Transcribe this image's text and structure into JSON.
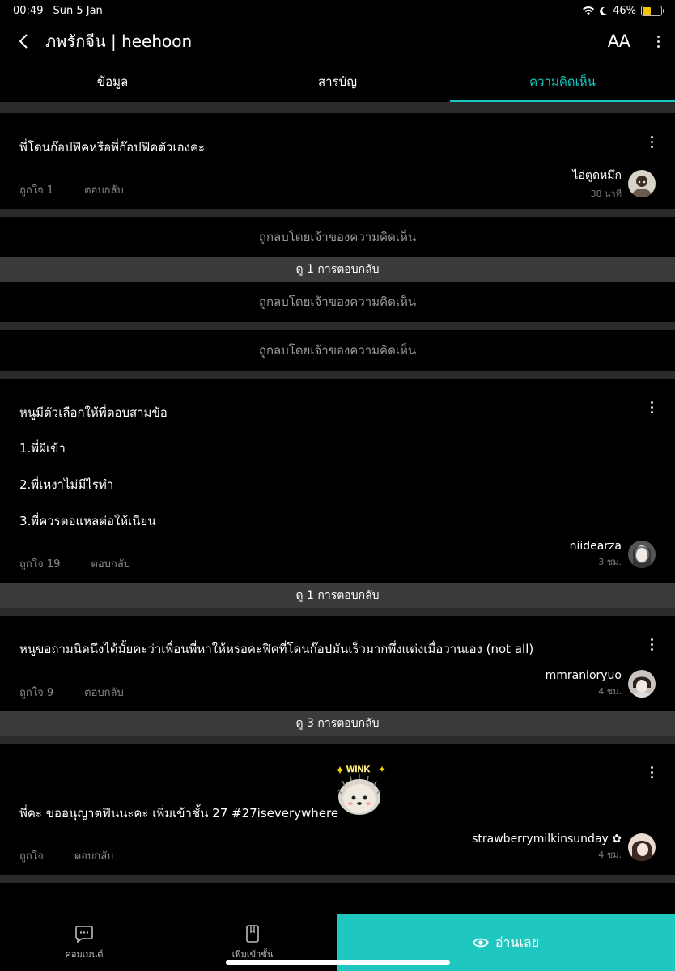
{
  "status": {
    "time": "00:49",
    "date": "Sun 5 Jan",
    "battery": "46%",
    "battery_level": 0.46
  },
  "header": {
    "title": "ภพรักจีน | heehoon",
    "font_button": "AA"
  },
  "tabs": [
    {
      "label": "ข้อมูล",
      "active": false
    },
    {
      "label": "สารบัญ",
      "active": false
    },
    {
      "label": "ความคิดเห็น",
      "active": true
    }
  ],
  "comments": [
    {
      "text": "พี่โดนก๊อปฟิคหรือพี่ก๊อปฟิคตัวเองคะ",
      "likes": "ถูกใจ 1",
      "reply": "ตอบกลับ",
      "user": "ไอ่ตูดหมึก",
      "time": "38 นาที"
    },
    {
      "deleted": "ถูกลบโดยเจ้าของความคิดเห็น",
      "replies": "ดู 1 การตอบกลับ"
    },
    {
      "deleted": "ถูกลบโดยเจ้าของความคิดเห็น"
    },
    {
      "deleted": "ถูกลบโดยเจ้าของความคิดเห็น"
    },
    {
      "lines": [
        "หนูมีตัวเลือกให้พี่ตอบสามข้อ",
        "1.พี่ผีเข้า",
        "2.พี่เหงาไม่มีไรทำ",
        "3.พี่ควรตอแหลต่อให้เนียน"
      ],
      "likes": "ถูกใจ 19",
      "reply": "ตอบกลับ",
      "user": "niidearza",
      "time": "3 ชม.",
      "replies": "ดู 1 การตอบกลับ"
    },
    {
      "text": "หนูขอถามนิดนึงได้มั้ยคะว่าเพื่อนพี่หาให้หรอคะฟิคที่โดนก๊อปมันเร็วมากพึ่งแต่งเมื่อวานเอง (not all)",
      "likes": "ถูกใจ 9",
      "reply": "ตอบกลับ",
      "user": "mmranioryuo",
      "time": "4 ชม.",
      "replies": "ดู 3 การตอบกลับ"
    },
    {
      "text": "พี่คะ ขออนุญาตฟินนะคะ เพิ่มเข้าชั้น 27 #27iseverywhere",
      "sticker": "WINK",
      "likes": "ถูกใจ",
      "reply": "ตอบกลับ",
      "user": "strawberrymilkinsunday ✿",
      "time": "4 ชม."
    }
  ],
  "bottom": {
    "comment": "คอมเมนต์",
    "shelf": "เพิ่มเข้าชั้น",
    "read": "อ่านเลย"
  },
  "colors": {
    "accent": "#17c8c2",
    "read_button": "#1ec8c0"
  }
}
